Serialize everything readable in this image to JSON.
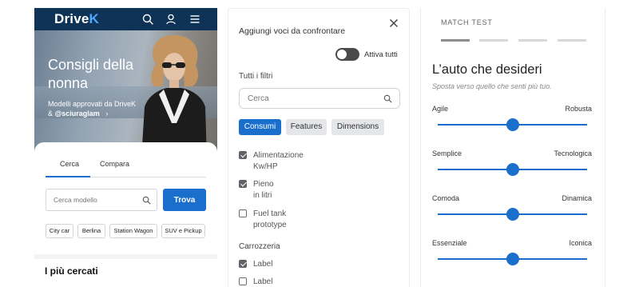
{
  "app": {
    "brand_main": "Drive",
    "brand_accent": "K",
    "hero": {
      "title": "Consigli della nonna",
      "subtitle_line1": "Modelli approvati da DriveK",
      "subtitle_line2_prefix": "& ",
      "subtitle_handle": "@sciuraglam",
      "subtitle_arrow": "›"
    },
    "tabs": [
      {
        "label": "Cerca",
        "active": true
      },
      {
        "label": "Compara",
        "active": false
      }
    ],
    "search": {
      "placeholder": "Cerca modello",
      "button_label": "Trova"
    },
    "chips": [
      "City car",
      "Berlina",
      "Station Wagon",
      "SUV e Pickup"
    ],
    "section_title": "I più cercati",
    "icons": [
      "search-icon",
      "user-icon",
      "menu-icon",
      "close-icon"
    ]
  },
  "compare": {
    "title": "Aggiungi voci da confrontare",
    "toggle": {
      "label": "Attiva tutti",
      "on": false
    },
    "filters_heading": "Tutti i filtri",
    "search_placeholder": "Cerca",
    "filter_tabs": [
      {
        "label": "Consumi",
        "active": true
      },
      {
        "label": "Features",
        "active": false
      },
      {
        "label": "Dimensions",
        "active": false
      }
    ],
    "items": [
      {
        "label_line1": "Alimentazione",
        "label_line2": "Kw/HP",
        "checked": true
      },
      {
        "label_line1": "Pieno",
        "label_line2": "in litri",
        "checked": true
      },
      {
        "label_line1": "Fuel tank",
        "label_line2": "prototype",
        "checked": false
      }
    ],
    "section2_title": "Carrozzeria",
    "section2_items": [
      {
        "label": "Label",
        "checked": true
      },
      {
        "label": "Label",
        "checked": false
      }
    ]
  },
  "match": {
    "label": "MATCH TEST",
    "progress": {
      "total_steps": 4,
      "completed_steps": 1
    },
    "title": "L’auto che desideri",
    "subtitle": "Sposta verso quello che senti più tuo.",
    "sliders": [
      {
        "left": "Agile",
        "right": "Robusta",
        "value": 0.5
      },
      {
        "left": "Semplice",
        "right": "Tecnologica",
        "value": 0.5
      },
      {
        "left": "Comoda",
        "right": "Dinamica",
        "value": 0.5
      },
      {
        "left": "Essenziale",
        "right": "Iconica",
        "value": 0.5
      }
    ]
  },
  "colors": {
    "navy": "#0f3356",
    "primary_blue": "#1a6fcc",
    "accent_light_blue": "#4ea8ff",
    "chip_grey": "#e4e6e9",
    "checkbox_dark": "#5f6368"
  }
}
